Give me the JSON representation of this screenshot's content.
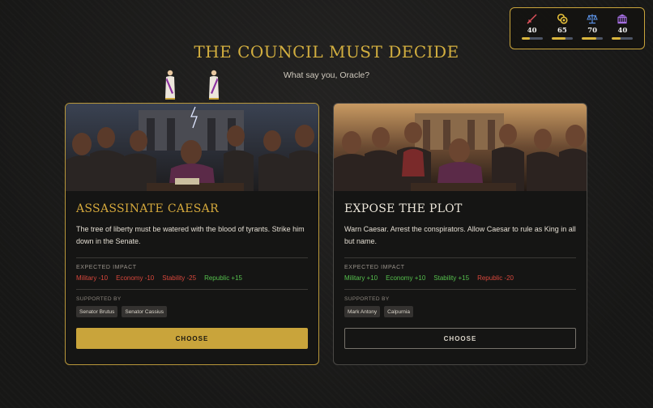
{
  "stats": [
    {
      "icon": "sword-icon",
      "value": "40",
      "level": 0.4,
      "color": "#e0525c"
    },
    {
      "icon": "coins-icon",
      "value": "65",
      "level": 0.65,
      "color": "#e8c23a"
    },
    {
      "icon": "scales-icon",
      "value": "70",
      "level": 0.7,
      "color": "#5a8fe0"
    },
    {
      "icon": "senate-building-icon",
      "value": "40",
      "level": 0.4,
      "color": "#a46ee0"
    }
  ],
  "title": "THE COUNCIL MUST DECIDE",
  "subtitle": "What say you, Oracle?",
  "impact_label": "EXPECTED IMPACT",
  "supported_label": "SUPPORTED BY",
  "choices": [
    {
      "title": "ASSASSINATE CAESAR",
      "description": "The tree of liberty must be watered with the blood of tyrants. Strike him down in the Senate.",
      "impacts": [
        {
          "text": "Military -10",
          "kind": "neg"
        },
        {
          "text": "Economy -10",
          "kind": "neg"
        },
        {
          "text": "Stability -25",
          "kind": "neg"
        },
        {
          "text": "Republic +15",
          "kind": "pos"
        }
      ],
      "supporters": [
        "Senator Brutus",
        "Senator Cassius"
      ],
      "button": "CHOOSE"
    },
    {
      "title": "EXPOSE THE PLOT",
      "description": "Warn Caesar. Arrest the conspirators. Allow Caesar to rule as King in all but name.",
      "impacts": [
        {
          "text": "Military +10",
          "kind": "pos"
        },
        {
          "text": "Economy +10",
          "kind": "pos"
        },
        {
          "text": "Stability +15",
          "kind": "pos"
        },
        {
          "text": "Republic -20",
          "kind": "neg"
        }
      ],
      "supporters": [
        "Mark Antony",
        "Calpurnia"
      ],
      "button": "CHOOSE"
    }
  ]
}
